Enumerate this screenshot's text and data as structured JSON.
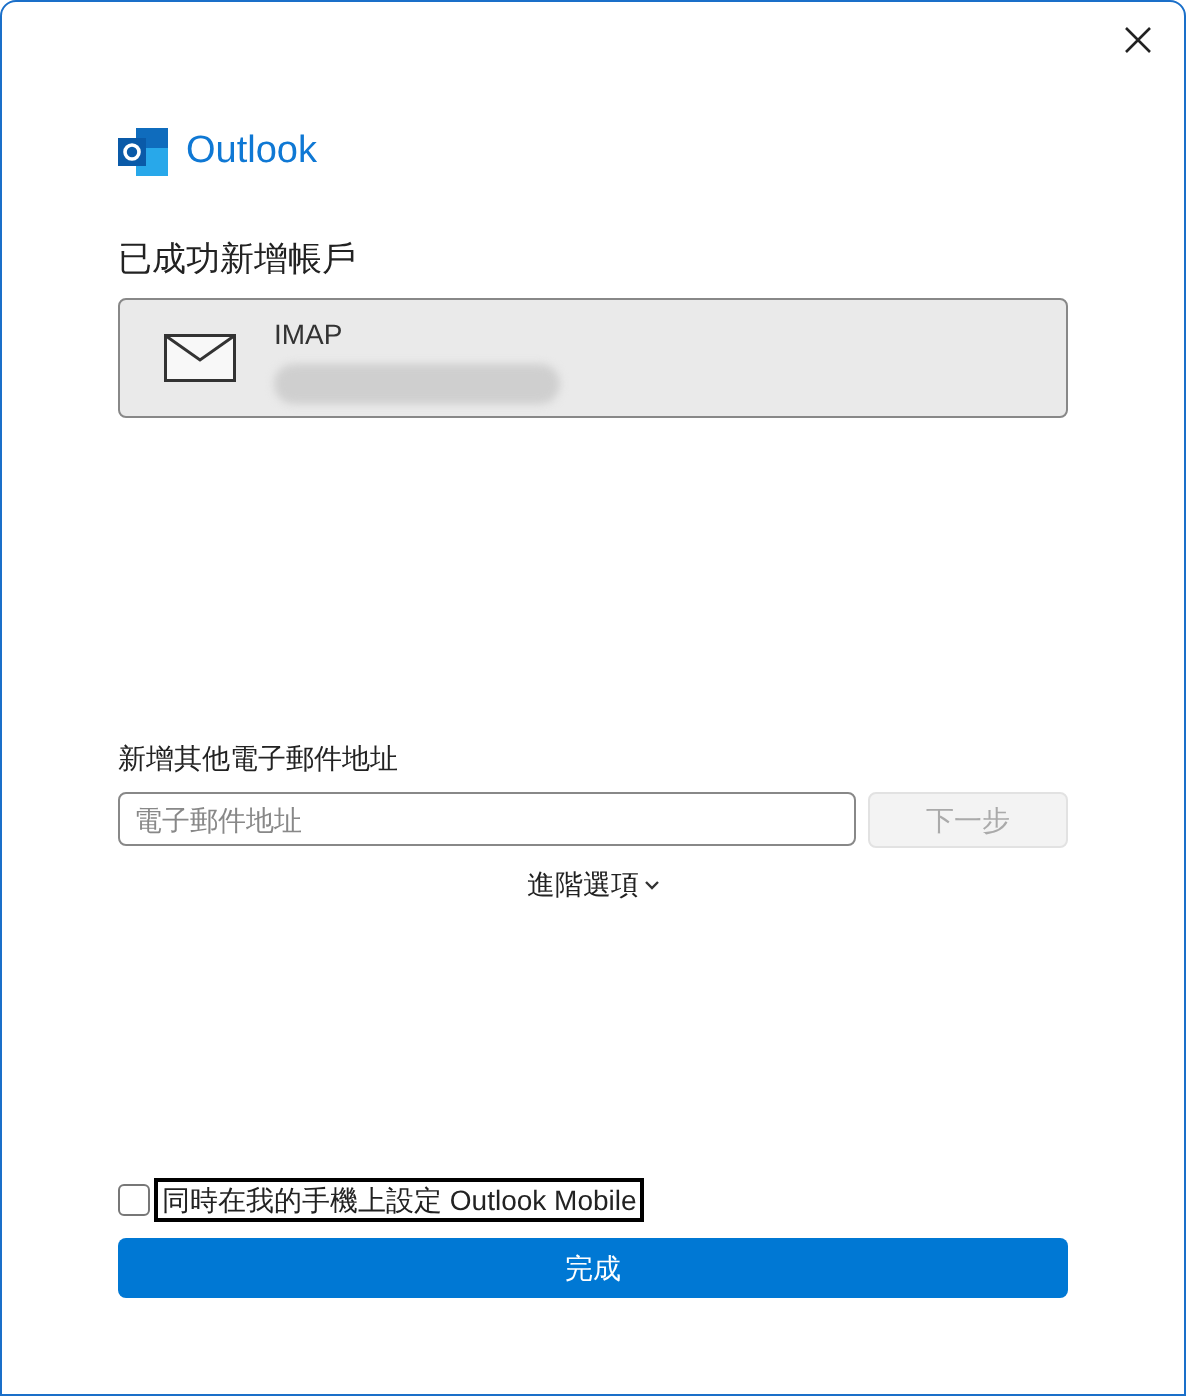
{
  "brand": {
    "name": "Outlook"
  },
  "heading": "已成功新增帳戶",
  "account": {
    "type": "IMAP"
  },
  "add_email": {
    "label": "新增其他電子郵件地址",
    "placeholder": "電子郵件地址",
    "next_button": {
      "label": "下一步",
      "disabled": true
    }
  },
  "advanced_options": {
    "label": "進階選項",
    "expanded": false
  },
  "mobile_option": {
    "label": "同時在我的手機上設定 Outlook Mobile",
    "checked": false,
    "focused": true
  },
  "finish_button": {
    "label": "完成"
  }
}
